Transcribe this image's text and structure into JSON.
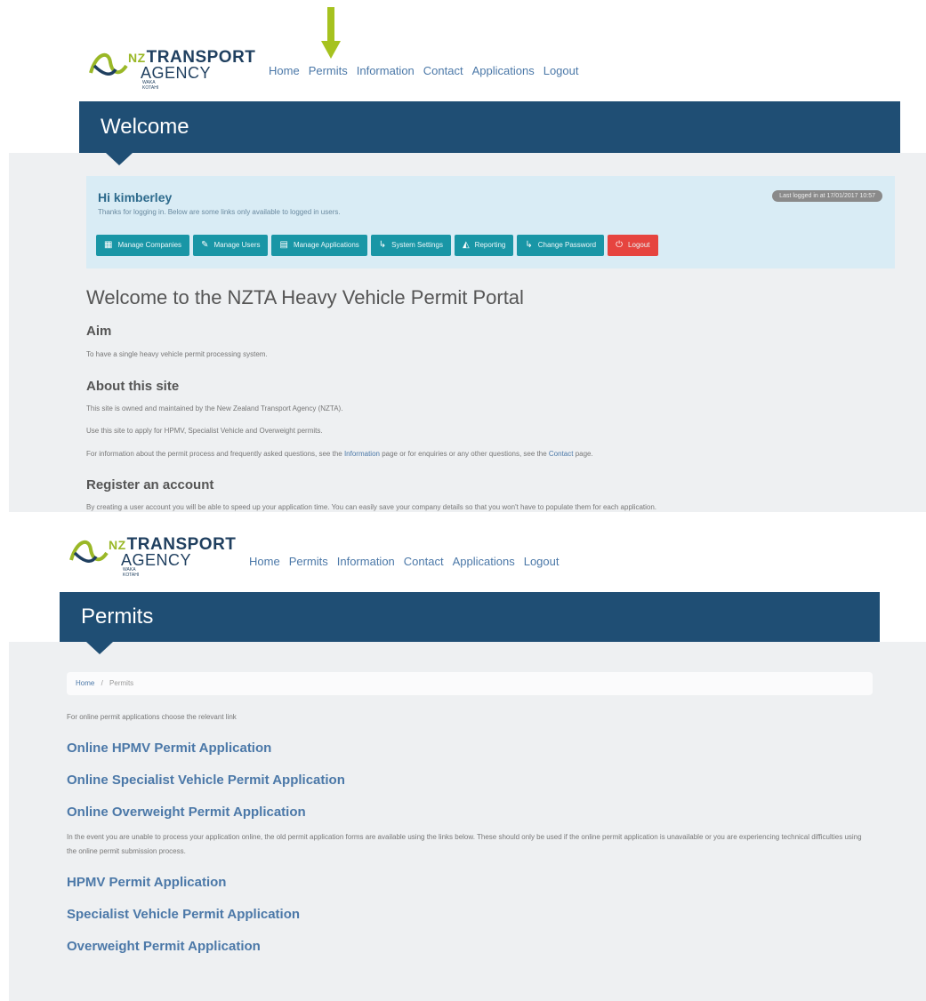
{
  "colors": {
    "arrow": "#a6c21f",
    "header": "#1f4e74",
    "teal": "#1996a6",
    "red": "#e6443f",
    "link": "#4b78a8"
  },
  "logo": {
    "nz": "NZ",
    "line1": "TRANSPORT",
    "line2": "AGENCY",
    "line3": "WAKA KOTAHI"
  },
  "nav": [
    "Home",
    "Permits",
    "Information",
    "Contact",
    "Applications",
    "Logout"
  ],
  "welcome": {
    "banner": "Welcome",
    "greeting": "Hi kimberley",
    "thanks": "Thanks for logging in. Below are some links only available to logged in users.",
    "last_logged": "Last logged in at 17/01/2017 10:57",
    "buttons": [
      {
        "label": "Manage Companies",
        "icon": "building-icon"
      },
      {
        "label": "Manage Users",
        "icon": "user-icon"
      },
      {
        "label": "Manage Applications",
        "icon": "document-icon"
      },
      {
        "label": "System Settings",
        "icon": "wrench-icon"
      },
      {
        "label": "Reporting",
        "icon": "chart-icon"
      },
      {
        "label": "Change Password",
        "icon": "key-icon"
      },
      {
        "label": "Logout",
        "icon": "power-icon"
      }
    ],
    "heading": "Welcome to the NZTA Heavy Vehicle Permit Portal",
    "aim_heading": "Aim",
    "aim_text": "To have a single heavy vehicle permit processing system.",
    "about_heading": "About this site",
    "about_p1": "This site is owned and maintained by the New Zealand Transport Agency (NZTA).",
    "about_p2": "Use this site to apply for HPMV, Specialist Vehicle and Overweight permits.",
    "about_p3_a": "For information about the permit process and frequently asked questions, see the ",
    "about_p3_link1": "Information",
    "about_p3_b": " page or for enquiries or any other questions, see the ",
    "about_p3_link2": "Contact",
    "about_p3_c": " page.",
    "register_heading": "Register an account",
    "register_text": "By creating a user account you will be able to speed up your application time. You can easily save your company details so that you won't have to populate them for each application."
  },
  "permits": {
    "banner": "Permits",
    "breadcrumb_home": "Home",
    "breadcrumb_sep": "/",
    "breadcrumb_current": "Permits",
    "intro": "For online permit applications choose the relevant link",
    "online_links": [
      "Online HPMV Permit Application",
      "Online Specialist Vehicle Permit Application",
      "Online Overweight Permit Application"
    ],
    "paper_note": "In the event you are unable to process your application online, the old permit application forms are available using the links below. These should only be used if the online permit application is unavailable or you are experiencing technical difficulties using the online permit submission process.",
    "paper_links": [
      "HPMV Permit Application",
      "Specialist Vehicle Permit Application",
      "Overweight Permit Application"
    ]
  }
}
